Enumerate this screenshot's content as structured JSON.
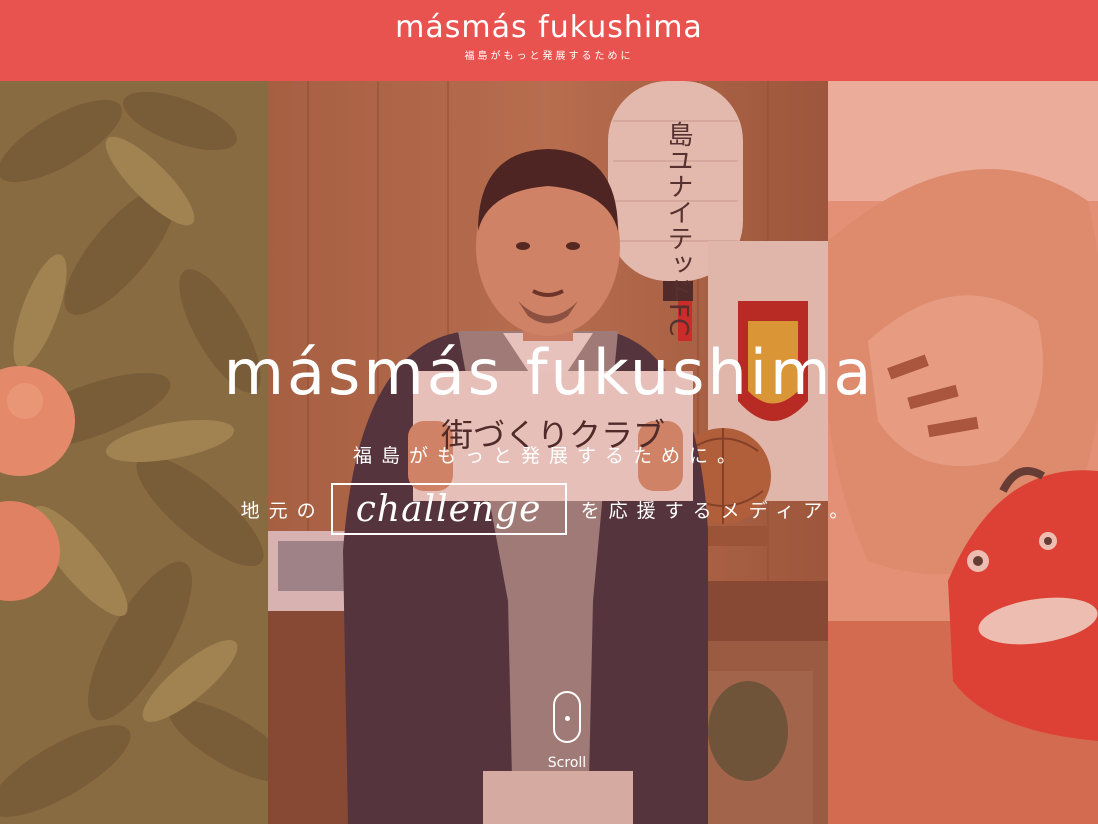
{
  "header": {
    "logo": "másmás fukushima",
    "tagline": "福島がもっと発展するために"
  },
  "hero": {
    "title": "másmás fukushima",
    "subtitle": "福島がもっと発展するために。",
    "line_prefix": "地元の",
    "highlight": "challenge",
    "line_suffix": "を応援するメディア。",
    "scroll_label": "Scroll",
    "photo_sign_text": "街づくりクラブ",
    "photo_lantern_text": "島ユナイテッドFC"
  },
  "colors": {
    "brand": "#e9534f",
    "text": "#ffffff"
  },
  "icons": {
    "scroll": "mouse-scroll-icon"
  }
}
